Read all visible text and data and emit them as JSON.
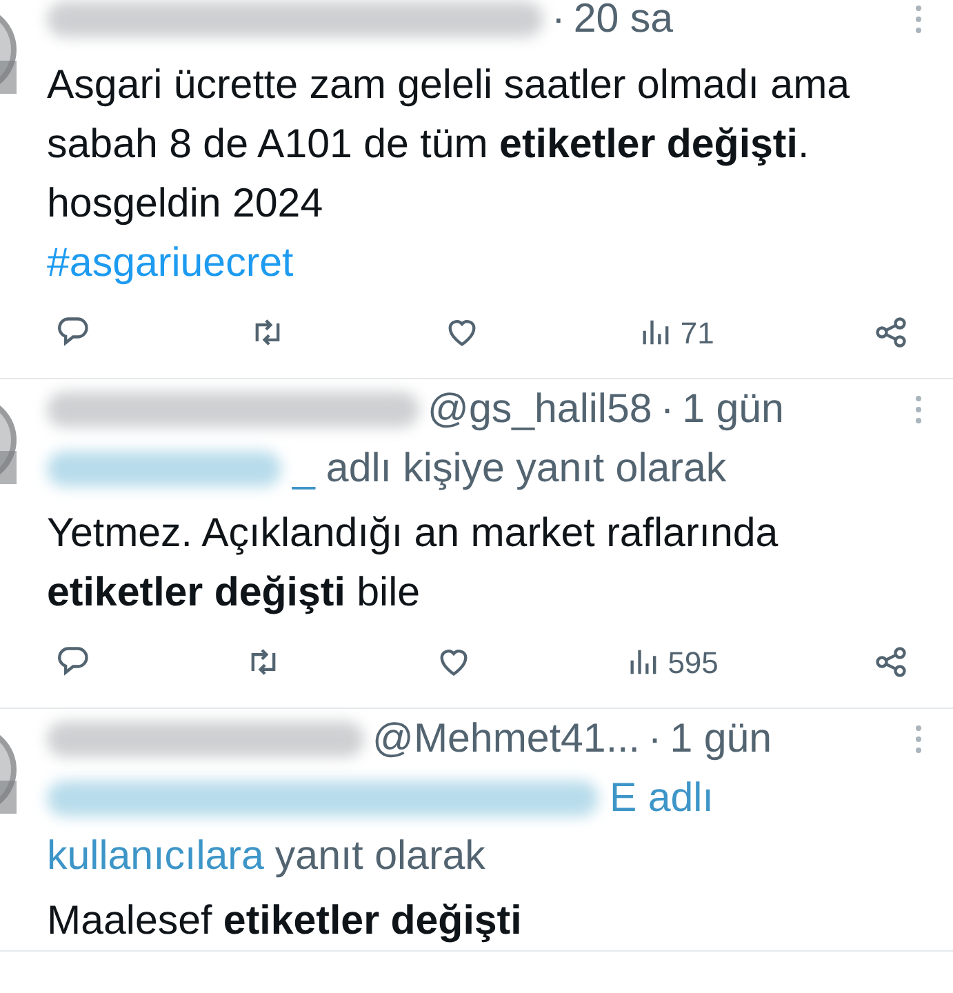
{
  "tweets": [
    {
      "dot": "·",
      "time": "20 sa",
      "body": "Asgari ücrette zam geleli saatler olmadı ama sabah 8 de A101 de tüm **etiketler değişti**. hosgeldin 2024",
      "hashtag": "#asgariuecret",
      "views": "71"
    },
    {
      "handle": "@gs_halil58",
      "dot": "·",
      "time": "1 gün",
      "reply_to": [
        {
          "text": "_",
          "kind": "mention"
        },
        {
          "text": "adlı kişiye yanıt olarak",
          "kind": "plain"
        }
      ],
      "body": "Yetmez. Açıklandığı an market raflarında **etiketler değişti** bile",
      "views": "595"
    },
    {
      "handle": "@Mehmet41...",
      "dot": "·",
      "time": "1 gün",
      "reply_to": [
        {
          "text": "E adlı",
          "kind": "mention"
        },
        {
          "text": "kullanıcılara",
          "kind": "mention"
        },
        {
          "text": "yanıt olarak",
          "kind": "plain"
        }
      ],
      "body": "Maalesef **etiketler değişti**"
    }
  ]
}
